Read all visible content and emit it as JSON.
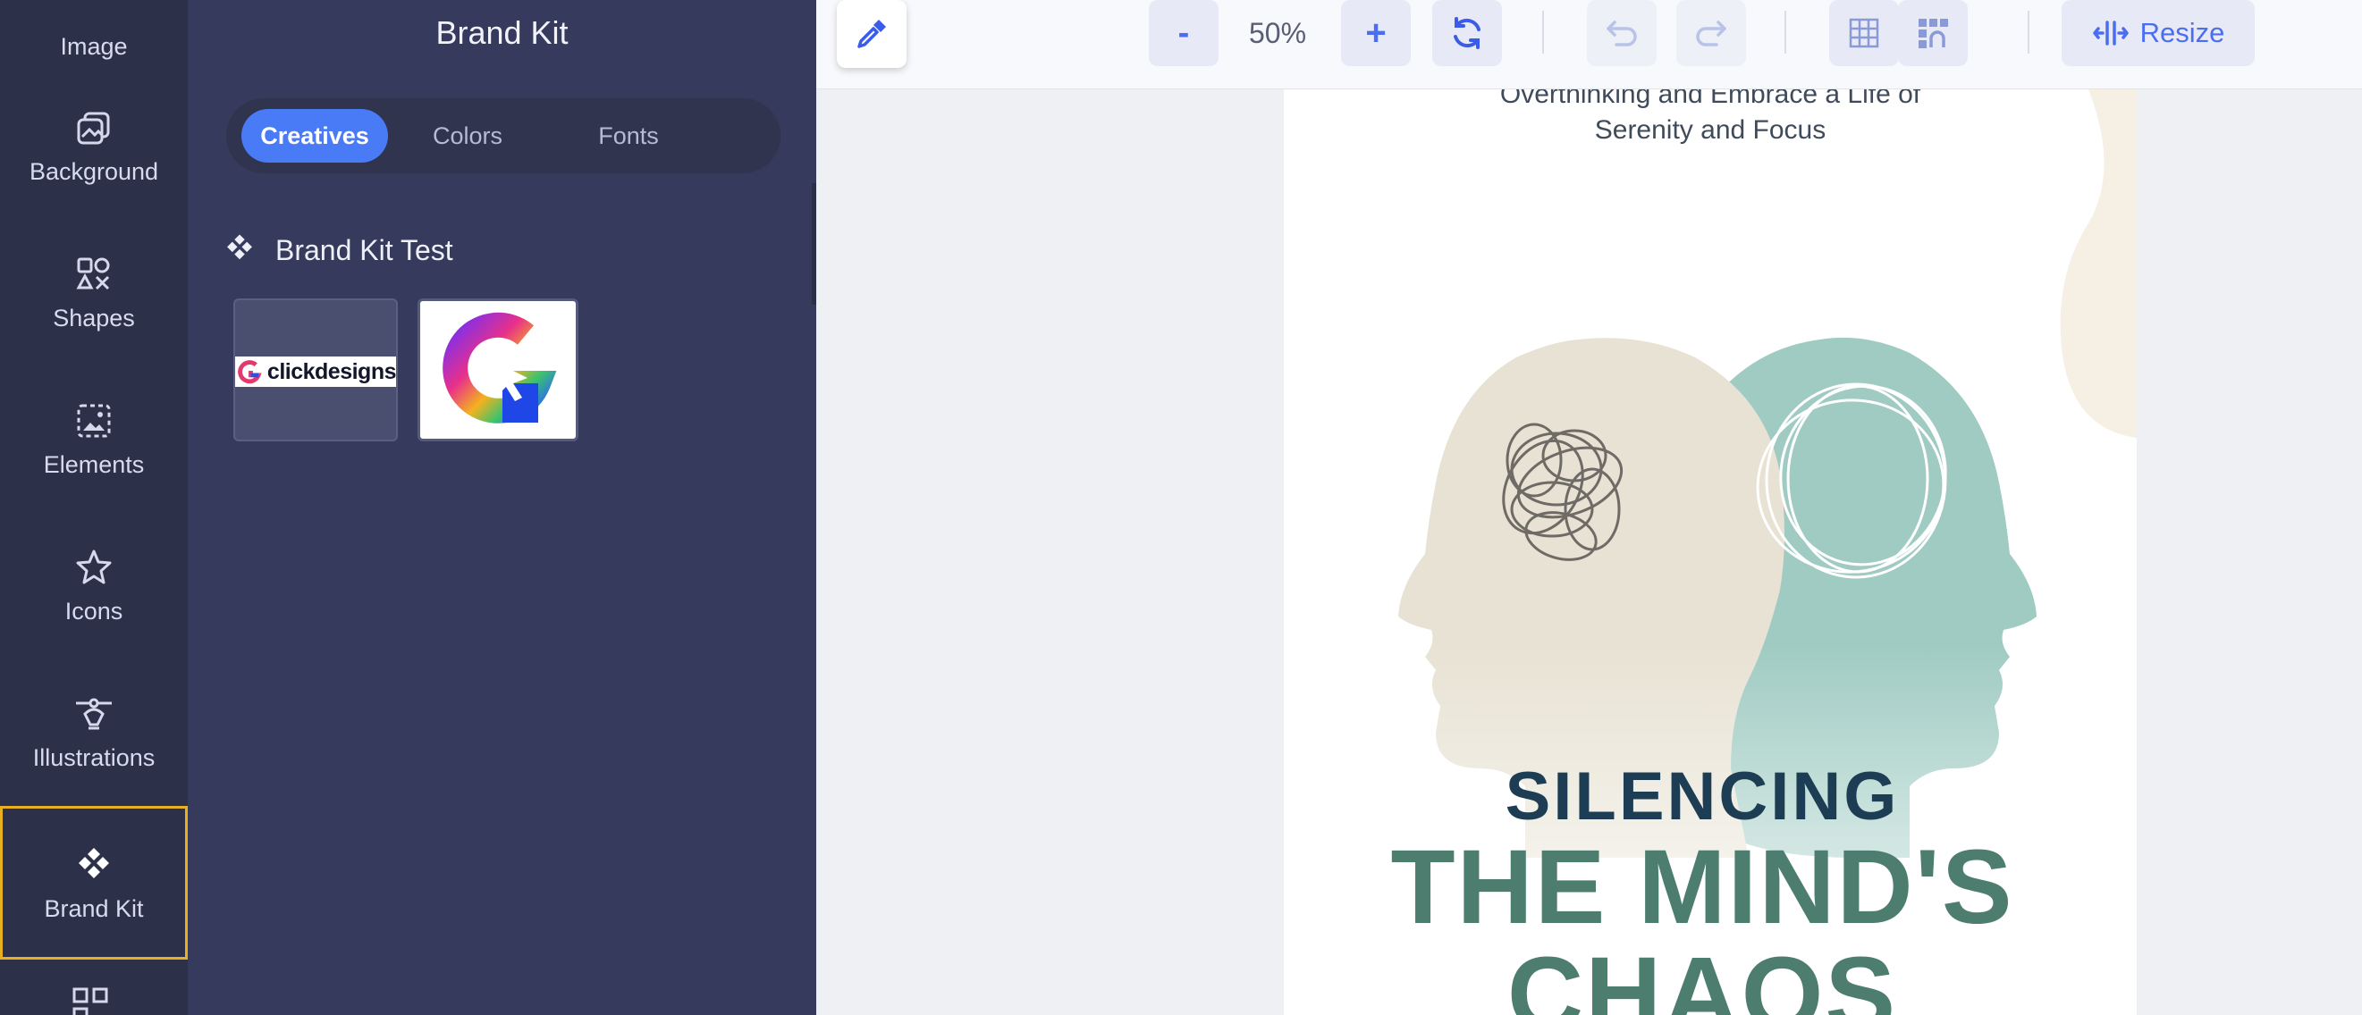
{
  "rail": {
    "items": [
      {
        "label": "Image",
        "icon": "image-icon"
      },
      {
        "label": "Background",
        "icon": "background-icon"
      },
      {
        "label": "Shapes",
        "icon": "shapes-icon"
      },
      {
        "label": "Elements",
        "icon": "elements-icon"
      },
      {
        "label": "Icons",
        "icon": "star-icon"
      },
      {
        "label": "Illustrations",
        "icon": "pen-tool-icon"
      },
      {
        "label": "Brand Kit",
        "icon": "diamond-grid-icon"
      }
    ],
    "active": "Brand Kit"
  },
  "panel": {
    "title": "Brand Kit",
    "tabs": [
      {
        "label": "Creatives",
        "active": true
      },
      {
        "label": "Colors",
        "active": false
      },
      {
        "label": "Fonts",
        "active": false
      }
    ],
    "section_title": "Brand Kit Test",
    "thumbnails": [
      {
        "label": "clickdesigns"
      }
    ]
  },
  "toolbar": {
    "zoom_out": "-",
    "zoom_level": "50%",
    "zoom_in": "+",
    "resize_label": "Resize"
  },
  "poster": {
    "subtitle_line1": "Overthinking and Embrace a Life of",
    "subtitle_line2": "Serenity and Focus",
    "title_line1": "SILENCING",
    "title_line2": "THE MIND'S",
    "title_line3": "CHAOS"
  },
  "colors": {
    "rail_bg": "#2d3049",
    "panel_bg": "#363a5c",
    "accent": "#4a7bf6",
    "active_outline": "#e8b020",
    "poster_green": "#4c7d6e",
    "poster_navy": "#1d3d54"
  }
}
